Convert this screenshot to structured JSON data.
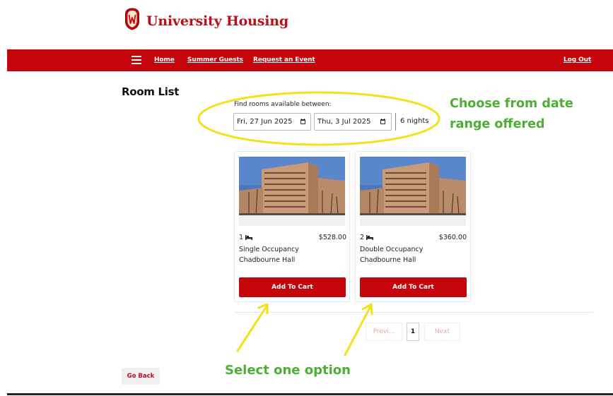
{
  "header": {
    "brand": "University Housing",
    "crest_icon": "uw-crest-icon"
  },
  "nav": {
    "menu_icon": "hamburger-icon",
    "links": [
      "Home",
      "Summer Guests",
      "Request an Event"
    ],
    "logout": "Log Out",
    "bar_color": "#c5050c"
  },
  "page": {
    "title": "Room List"
  },
  "dates": {
    "label": "Find rooms available between:",
    "start": "Fri, 27 Jun 2025",
    "end": "Thu, 3 Jul 2025",
    "nights": "6 nights",
    "calendar_icon": "calendar-icon"
  },
  "rooms": [
    {
      "beds": "1",
      "price": "$528.00",
      "type": "Single Occupancy",
      "hall": "Chadbourne Hall",
      "button": "Add To Cart"
    },
    {
      "beds": "2",
      "price": "$360.00",
      "type": "Double Occupancy",
      "hall": "Chadbourne Hall",
      "button": "Add To Cart"
    }
  ],
  "pagination": {
    "prev": "Previ...",
    "current": "1",
    "next": "Next"
  },
  "footer": {
    "go_back": "Go Back"
  },
  "annotations": {
    "date_note": "Choose from date range offered",
    "select_note": "Select one option",
    "note_color": "#4caf34",
    "highlight_color": "#f2e21a"
  }
}
